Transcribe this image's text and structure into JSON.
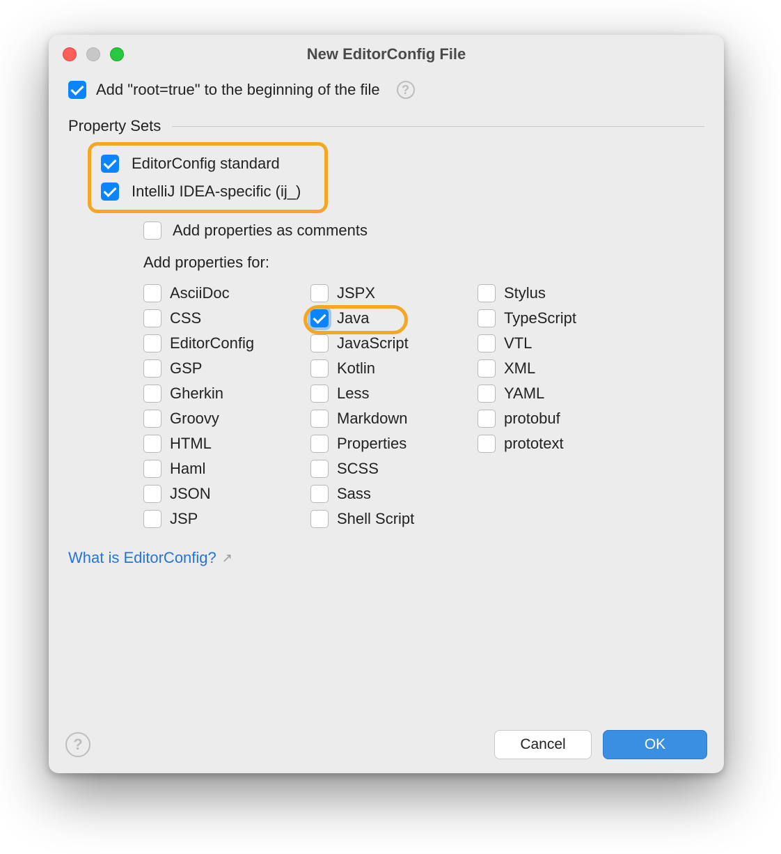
{
  "title": "New EditorConfig File",
  "rootCheckbox": {
    "label": "Add \"root=true\" to the beginning of the file",
    "checked": true
  },
  "section": "Property Sets",
  "propertySets": [
    {
      "label": "EditorConfig standard",
      "checked": true
    },
    {
      "label": "IntelliJ IDEA-specific (ij_)",
      "checked": true
    }
  ],
  "asComments": {
    "label": "Add properties as comments",
    "checked": false
  },
  "addFor": "Add properties for:",
  "languages": {
    "col1": [
      {
        "label": "AsciiDoc",
        "checked": false
      },
      {
        "label": "CSS",
        "checked": false
      },
      {
        "label": "EditorConfig",
        "checked": false
      },
      {
        "label": "GSP",
        "checked": false
      },
      {
        "label": "Gherkin",
        "checked": false
      },
      {
        "label": "Groovy",
        "checked": false
      },
      {
        "label": "HTML",
        "checked": false
      },
      {
        "label": "Haml",
        "checked": false
      },
      {
        "label": "JSON",
        "checked": false
      },
      {
        "label": "JSP",
        "checked": false
      }
    ],
    "col2": [
      {
        "label": "JSPX",
        "checked": false
      },
      {
        "label": "Java",
        "checked": true,
        "highlighted": true
      },
      {
        "label": "JavaScript",
        "checked": false
      },
      {
        "label": "Kotlin",
        "checked": false
      },
      {
        "label": "Less",
        "checked": false
      },
      {
        "label": "Markdown",
        "checked": false
      },
      {
        "label": "Properties",
        "checked": false
      },
      {
        "label": "SCSS",
        "checked": false
      },
      {
        "label": "Sass",
        "checked": false
      },
      {
        "label": "Shell Script",
        "checked": false
      }
    ],
    "col3": [
      {
        "label": "Stylus",
        "checked": false
      },
      {
        "label": "TypeScript",
        "checked": false
      },
      {
        "label": "VTL",
        "checked": false
      },
      {
        "label": "XML",
        "checked": false
      },
      {
        "label": "YAML",
        "checked": false
      },
      {
        "label": "protobuf",
        "checked": false
      },
      {
        "label": "prototext",
        "checked": false
      }
    ]
  },
  "link": "What is EditorConfig?",
  "buttons": {
    "cancel": "Cancel",
    "ok": "OK"
  }
}
